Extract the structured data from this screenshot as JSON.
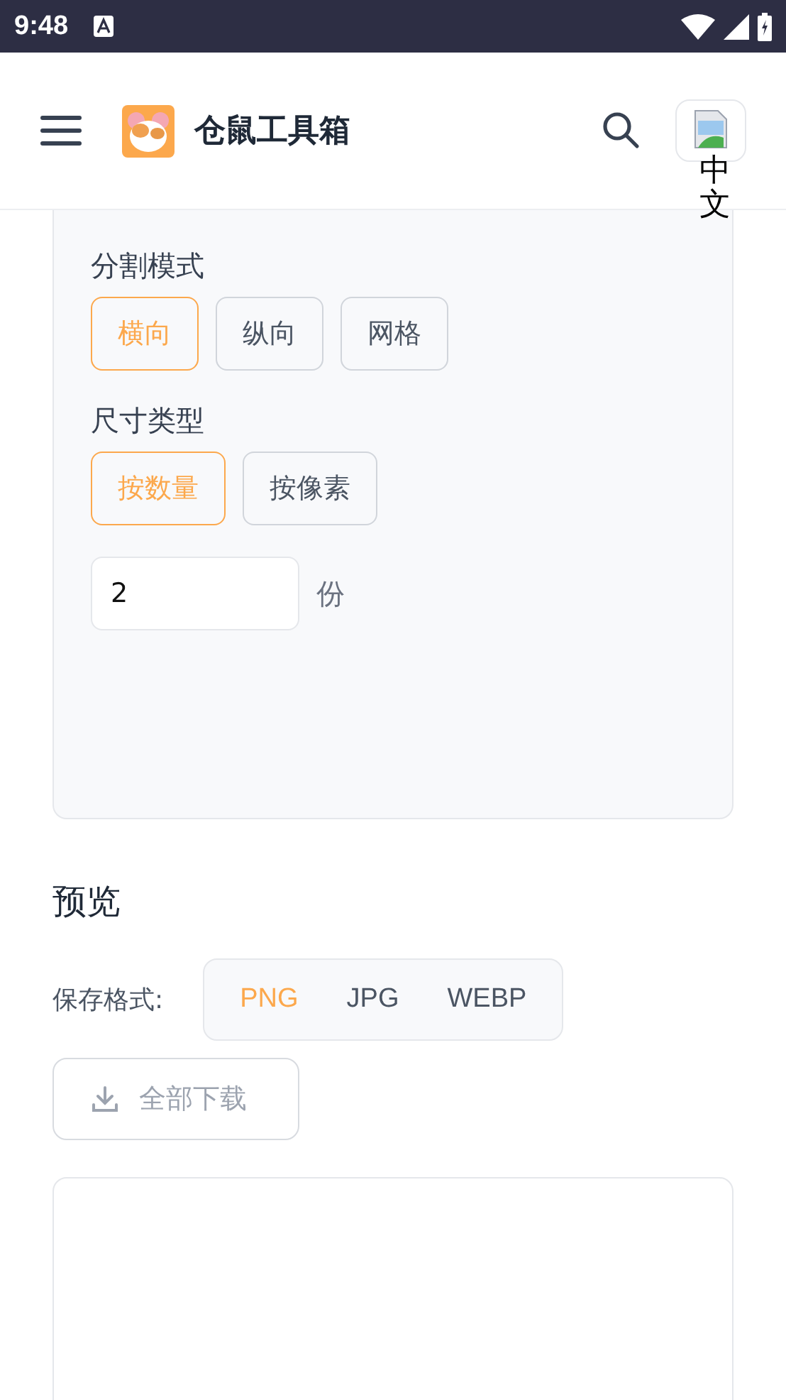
{
  "status_bar": {
    "time": "9:48"
  },
  "header": {
    "title": "仓鼠工具箱",
    "language_alt": "中文"
  },
  "split_settings": {
    "mode_label": "分割模式",
    "modes": [
      {
        "label": "横向",
        "selected": true
      },
      {
        "label": "纵向",
        "selected": false
      },
      {
        "label": "网格",
        "selected": false
      }
    ],
    "size_label": "尺寸类型",
    "size_types": [
      {
        "label": "按数量",
        "selected": true
      },
      {
        "label": "按像素",
        "selected": false
      }
    ],
    "count_value": "2",
    "count_unit": "份"
  },
  "preview": {
    "title": "预览",
    "format_label": "保存格式:",
    "formats": [
      {
        "label": "PNG",
        "selected": true
      },
      {
        "label": "JPG",
        "selected": false
      },
      {
        "label": "WEBP",
        "selected": false
      }
    ],
    "download_button": {
      "label": "全部下载",
      "disabled": true
    }
  }
}
